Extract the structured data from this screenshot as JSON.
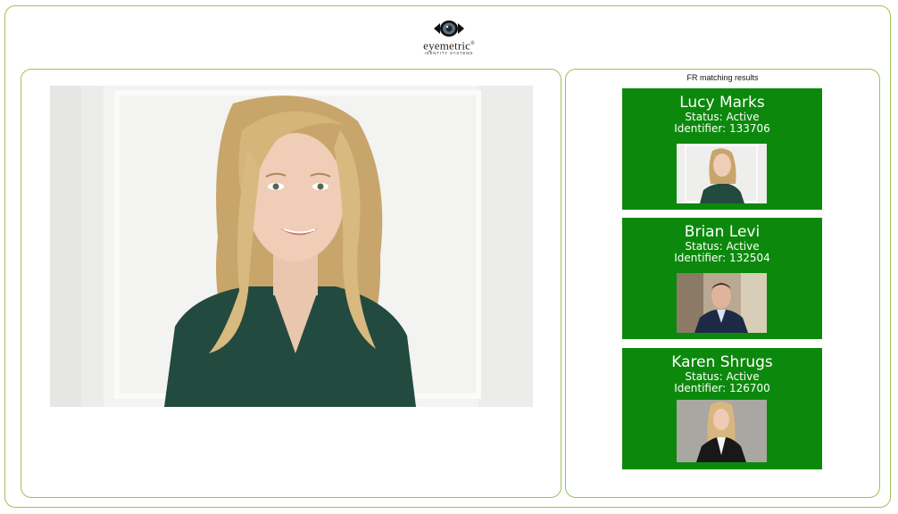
{
  "brand": {
    "name": "eyemetric",
    "registered": "®",
    "tagline": "IDENTITY SYSTEMS"
  },
  "results": {
    "title": "FR matching results",
    "matches": [
      {
        "name": "Lucy Marks",
        "status": "Status: Active",
        "identifier": "Identifier: 133706"
      },
      {
        "name": "Brian Levi",
        "status": "Status: Active",
        "identifier": "Identifier: 132504"
      },
      {
        "name": "Karen Shrugs",
        "status": "Status: Active",
        "identifier": "Identifier: 126700"
      }
    ]
  },
  "colors": {
    "accent_border": "#9cc15a",
    "card_green": "#0c890c"
  },
  "icons": [
    "eye-logo-icon"
  ]
}
